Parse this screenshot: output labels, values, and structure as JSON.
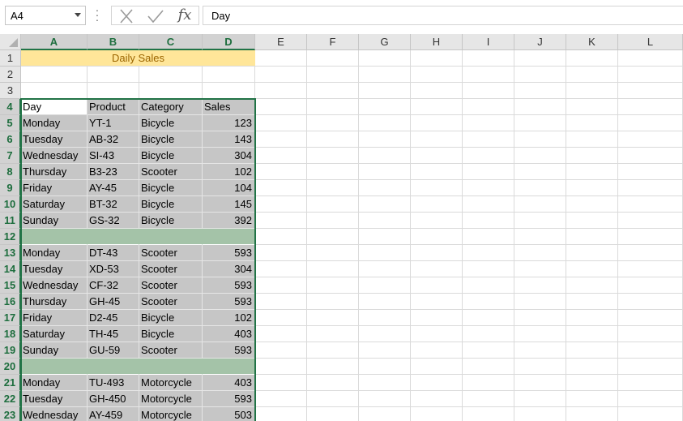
{
  "name_box": {
    "value": "A4"
  },
  "formula_bar": {
    "value": "Day",
    "fx_label": "fx"
  },
  "columns": [
    "A",
    "B",
    "C",
    "D",
    "E",
    "F",
    "G",
    "H",
    "I",
    "J",
    "K",
    "L"
  ],
  "rows": [
    "1",
    "2",
    "3",
    "4",
    "5",
    "6",
    "7",
    "8",
    "9",
    "10",
    "11",
    "12",
    "13",
    "14",
    "15",
    "16",
    "17",
    "18",
    "19",
    "20",
    "21",
    "22",
    "23"
  ],
  "title": "Daily Sales",
  "table": {
    "headers": [
      "Day",
      "Product",
      "Category",
      "Sales"
    ],
    "rows": [
      [
        "Monday",
        "YT-1",
        "Bicycle",
        "123"
      ],
      [
        "Tuesday",
        "AB-32",
        "Bicycle",
        "143"
      ],
      [
        "Wednesday",
        "SI-43",
        "Bicycle",
        "304"
      ],
      [
        "Thursday",
        "B3-23",
        "Scooter",
        "102"
      ],
      [
        "Friday",
        "AY-45",
        "Bicycle",
        "104"
      ],
      [
        "Saturday",
        "BT-32",
        "Bicycle",
        "145"
      ],
      [
        "Sunday",
        "GS-32",
        "Bicycle",
        "392"
      ],
      null,
      [
        "Monday",
        "DT-43",
        "Scooter",
        "593"
      ],
      [
        "Tuesday",
        "XD-53",
        "Scooter",
        "304"
      ],
      [
        "Wednesday",
        "CF-32",
        "Scooter",
        "593"
      ],
      [
        "Thursday",
        "GH-45",
        "Scooter",
        "593"
      ],
      [
        "Friday",
        "D2-45",
        "Bicycle",
        "102"
      ],
      [
        "Saturday",
        "TH-45",
        "Bicycle",
        "403"
      ],
      [
        "Sunday",
        "GU-59",
        "Scooter",
        "593"
      ],
      null,
      [
        "Monday",
        "TU-493",
        "Motorcycle",
        "403"
      ],
      [
        "Tuesday",
        "GH-450",
        "Motorcycle",
        "593"
      ],
      [
        "Wednesday",
        "AY-459",
        "Motorcycle",
        "503"
      ]
    ]
  },
  "colors": {
    "selection": "#217346",
    "selection_fill": "#c6c6c6",
    "band_fill": "#a4c3a8",
    "title_fill": "#ffe699",
    "title_text": "#9c6500"
  }
}
